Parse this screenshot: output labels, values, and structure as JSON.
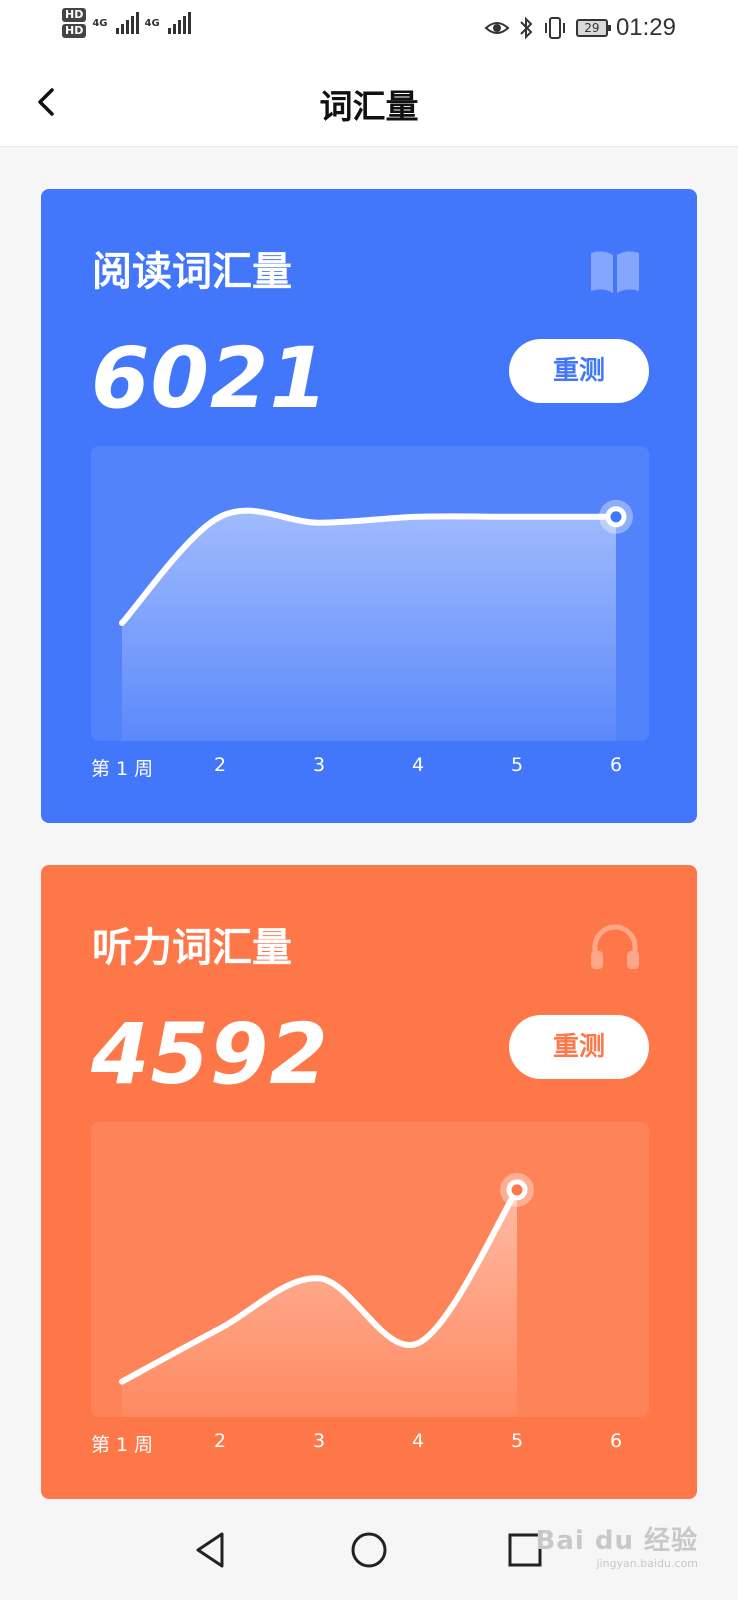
{
  "status_bar": {
    "sim1": "HD",
    "sim2": "HD",
    "network1": "4G",
    "network2": "4G",
    "battery": "29",
    "time": "01:29",
    "icons": [
      "eye-icon",
      "bluetooth-icon",
      "vibrate-icon",
      "battery-icon"
    ]
  },
  "header": {
    "title": "词汇量",
    "back_icon": "chevron-left-icon"
  },
  "cards": [
    {
      "title": "阅读词汇量",
      "value": "6021",
      "retest_label": "重测",
      "icon": "book-icon",
      "color": "#4277fb"
    },
    {
      "title": "听力词汇量",
      "value": "4592",
      "retest_label": "重测",
      "icon": "headphones-icon",
      "color": "#fe7749"
    }
  ],
  "weeks": [
    "第 1 周",
    "2",
    "3",
    "4",
    "5",
    "6"
  ],
  "chart_data": [
    {
      "type": "area",
      "series": [
        {
          "values": [
            0.4,
            0.76,
            0.74,
            0.76,
            0.76,
            0.76
          ]
        }
      ],
      "highlight_index": 5,
      "y_axis_labels": "none"
    },
    {
      "type": "area",
      "series": [
        {
          "values": [
            0.12,
            0.3,
            0.47,
            0.25,
            0.77
          ]
        }
      ],
      "highlight_index": 4,
      "y_axis_labels": "none"
    }
  ],
  "nav_bar": {
    "buttons": [
      "back-triangle-icon",
      "home-circle-icon",
      "recents-square-icon"
    ]
  },
  "watermark": {
    "text": "Bai du 经验",
    "sub": "jingyan.baidu.com"
  }
}
